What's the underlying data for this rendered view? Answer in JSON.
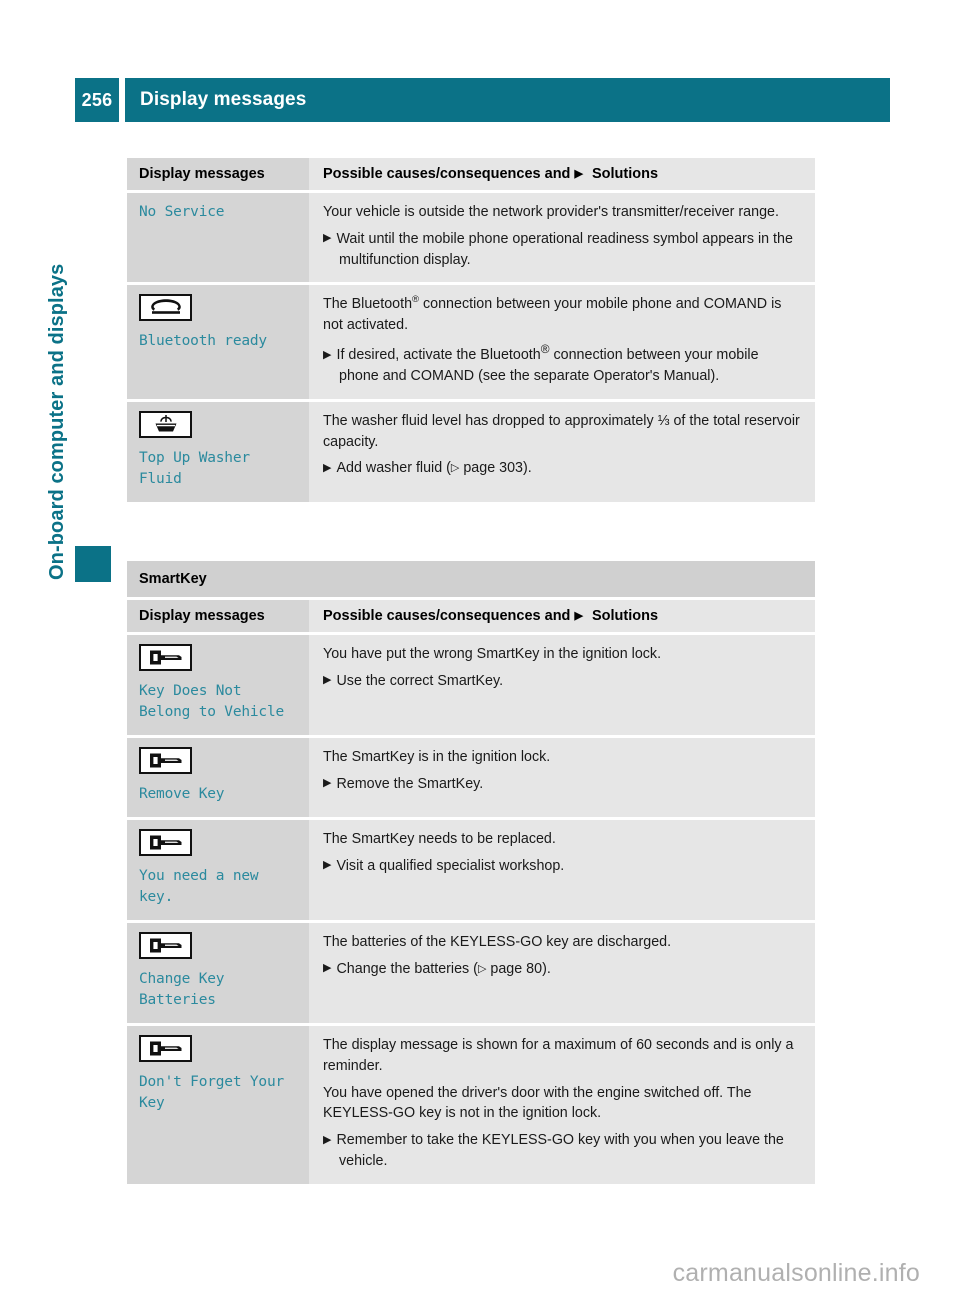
{
  "header": {
    "page_number": "256",
    "title": "Display messages"
  },
  "side_tab": {
    "chapter": "On-board computer and displays"
  },
  "table_headers": {
    "col1": "Display messages",
    "col2_prefix": "Possible causes/consequences and",
    "col2_suffix": "Solutions"
  },
  "section_smartkey": {
    "title": "SmartKey"
  },
  "table1": [
    {
      "icon": null,
      "message": "No Service",
      "paragraphs": [
        "Your vehicle is outside the network provider's transmitter/receiver range."
      ],
      "steps": [
        "Wait until the mobile phone operational readiness symbol appears in the multifunction display."
      ]
    },
    {
      "icon": "phone-handset-icon",
      "message": "Bluetooth ready",
      "paragraphs_rich": [
        {
          "pre": "The Bluetooth",
          "sup": "®",
          "post": " connection between your mobile phone and COMAND is not activated."
        }
      ],
      "steps_rich": [
        {
          "pre": "If desired, activate the Bluetooth",
          "sup": "®",
          "post": " connection between your mobile phone and COMAND (see the separate Operator's Manual)."
        }
      ]
    },
    {
      "icon": "washer-fluid-icon",
      "message": "Top Up Washer Fluid",
      "paragraphs": [
        "The washer fluid level has dropped to approximately ⅓ of the total reservoir capacity."
      ],
      "steps_xref": [
        {
          "pre": "Add washer fluid (",
          "xref": "page 303",
          "post": ")."
        }
      ]
    }
  ],
  "table2": [
    {
      "icon": "smartkey-icon",
      "message": "Key Does Not\nBelong to Vehicle",
      "paragraphs": [
        "You have put the wrong SmartKey in the ignition lock."
      ],
      "steps": [
        "Use the correct SmartKey."
      ]
    },
    {
      "icon": "smartkey-icon",
      "message": "Remove Key",
      "paragraphs": [
        "The SmartKey is in the ignition lock."
      ],
      "steps": [
        "Remove the SmartKey."
      ]
    },
    {
      "icon": "smartkey-icon",
      "message": "You need a new key.",
      "paragraphs": [
        "The SmartKey needs to be replaced."
      ],
      "steps": [
        "Visit a qualified specialist workshop."
      ]
    },
    {
      "icon": "smartkey-icon",
      "message": "Change Key\nBatteries",
      "paragraphs": [
        "The batteries of the KEYLESS-GO key are discharged."
      ],
      "steps_xref": [
        {
          "pre": "Change the batteries (",
          "xref": "page 80",
          "post": ")."
        }
      ]
    },
    {
      "icon": "smartkey-icon",
      "message": "Don't Forget Your\nKey",
      "paragraphs": [
        "The display message is shown for a maximum of 60 seconds and is only a reminder.",
        "You have opened the driver's door with the engine switched off. The KEYLESS-GO key is not in the ignition lock."
      ],
      "steps": [
        "Remember to take the KEYLESS-GO key with you when you leave the vehicle."
      ]
    }
  ],
  "footer": {
    "watermark": "carmanualsonline.info"
  },
  "colors": {
    "accent_teal": "#0b7287",
    "message_teal": "#2b8a9e",
    "cell_left_bg": "#d5d5d5",
    "cell_right_bg": "#e6e6e6",
    "section_band_bg": "#d0d0d0"
  }
}
